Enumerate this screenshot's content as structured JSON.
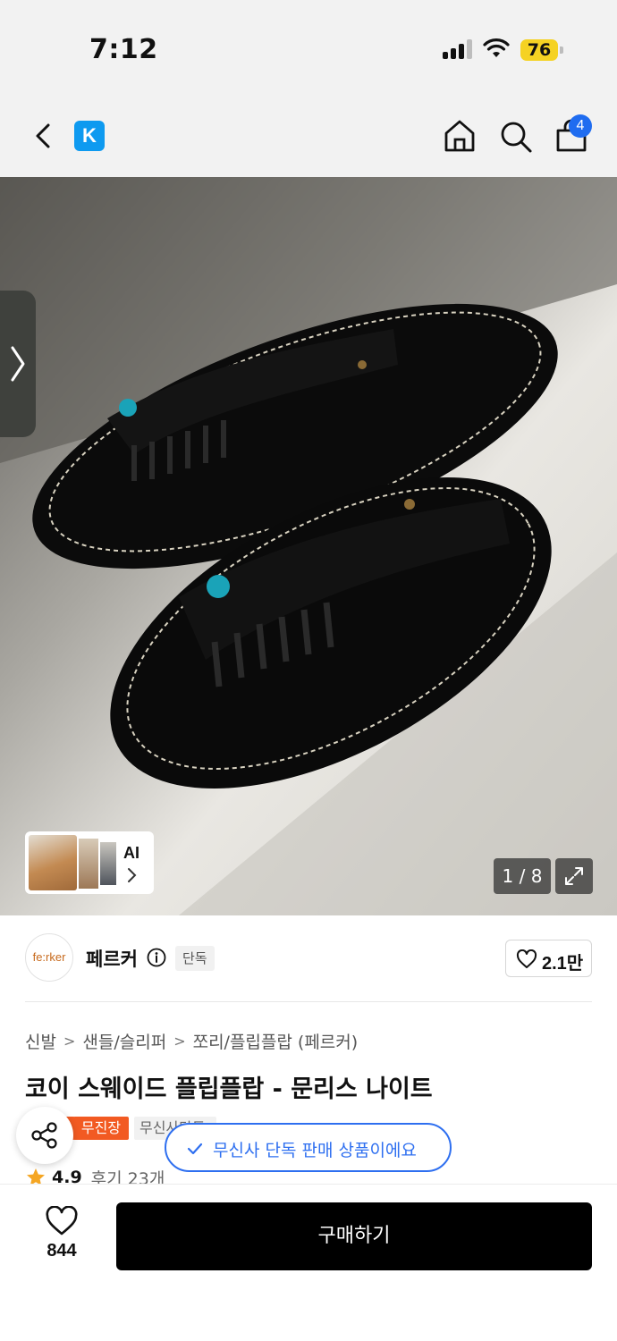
{
  "status_bar": {
    "time": "7:12",
    "battery": "76",
    "battery_color": "#f5d223",
    "icons": [
      "signal-icon",
      "wifi-icon",
      "battery-icon"
    ]
  },
  "top_nav": {
    "logo": "K",
    "logo_color": "#0e9af0",
    "cart_count": "4",
    "cart_badge_color": "#1f6cf0",
    "icons": [
      "back-icon",
      "home-icon",
      "search-icon",
      "cart-icon"
    ]
  },
  "gallery": {
    "ai_label": "AI",
    "page": "1 / 8",
    "icons": [
      "chevron-right-icon",
      "expand-icon"
    ]
  },
  "brand": {
    "logo_text": "fe:rker",
    "name": "페르커",
    "tag": "단독",
    "like_count": "2.1만"
  },
  "breadcrumb": [
    "신발",
    "샌들/슬리퍼",
    "쪼리/플립플랍 (페르커)"
  ],
  "product": {
    "title": "코이 스웨이드 플립플랍 - 문리스 나이트",
    "badge_red": "무진장",
    "badge_red_color": "#f25a22",
    "badge_gray": "무신사단독",
    "rating": "4.9",
    "reviews": "후기 23개"
  },
  "toast": {
    "text": "무신사 단독 판매 상품이에요",
    "color": "#2e6ff0"
  },
  "bottom_bar": {
    "wish_count": "844",
    "buy_label": "구매하기"
  }
}
